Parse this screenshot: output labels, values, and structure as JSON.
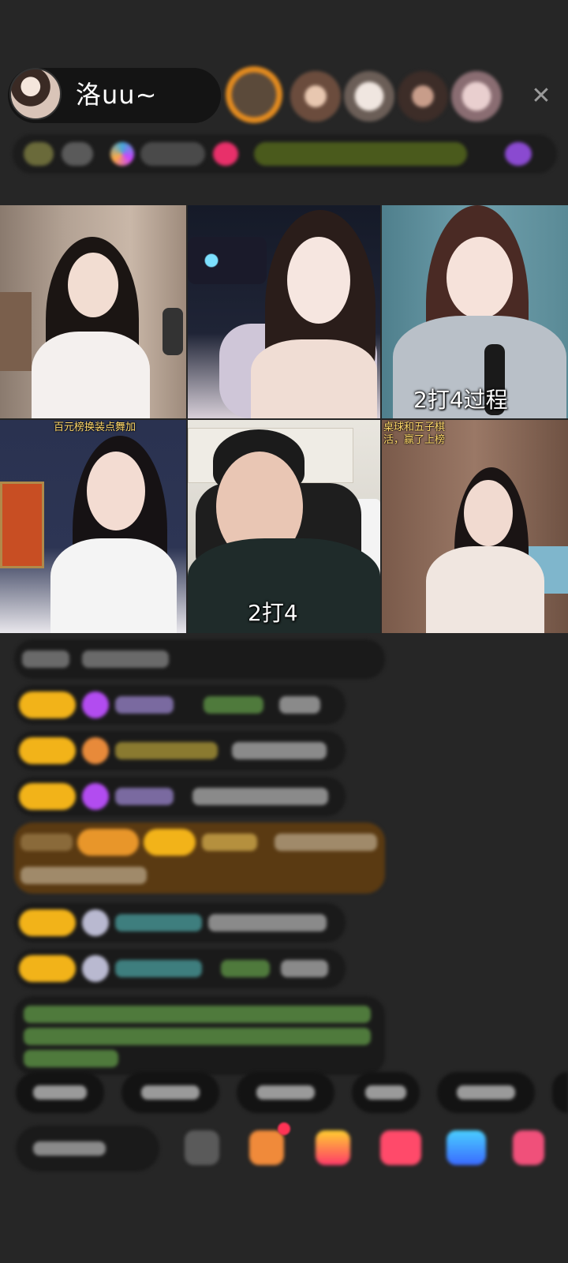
{
  "host": {
    "name": "洛uu~"
  },
  "top_bar": {
    "close_icon": "close-icon"
  },
  "video_grid": {
    "tiles": [
      {
        "caption": ""
      },
      {
        "caption": ""
      },
      {
        "caption": "2打4过程"
      },
      {
        "top_label": "百元榜换装点舞加",
        "caption": ""
      },
      {
        "caption": "2打4"
      },
      {
        "top_label_line1": "桌球和五子棋",
        "top_label_line2": "活，赢了上榜",
        "caption": ""
      }
    ]
  },
  "colors": {
    "background": "#262626",
    "chat_bubble": "#1a1a1a",
    "gold_badge": "#f2b319",
    "highlight_bubble": "#5a3a12",
    "green_text": "#6fbf4a",
    "purple_icon": "#b24cf0"
  }
}
